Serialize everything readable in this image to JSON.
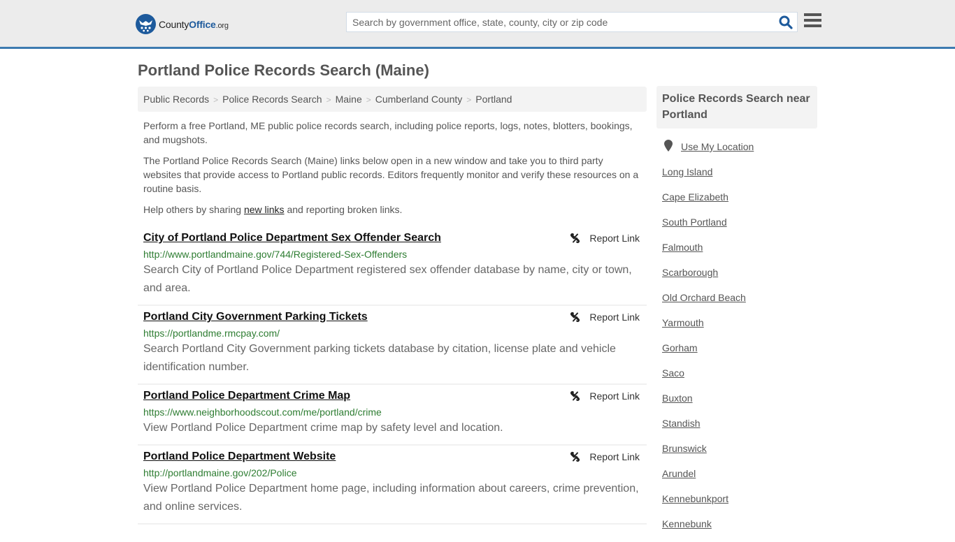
{
  "header": {
    "logo": {
      "part1": "County",
      "part2": "Office",
      "part3": ".org"
    },
    "search": {
      "placeholder": "Search by government office, state, county, city or zip code",
      "value": ""
    },
    "search_icon": "search-icon",
    "menu_icon": "hamburger-menu-icon",
    "colors": {
      "accent": "#3d7bb0",
      "brand": "#1d5a9c"
    }
  },
  "main": {
    "title": "Portland Police Records Search (Maine)",
    "breadcrumb": [
      "Public Records",
      "Police Records Search",
      "Maine",
      "Cumberland County",
      "Portland"
    ],
    "intro": {
      "p1": "Perform a free Portland, ME public police records search, including police reports, logs, notes, blotters, bookings, and mugshots.",
      "p2": "The Portland Police Records Search (Maine) links below open in a new window and take you to third party websites that provide access to Portland public records. Editors frequently monitor and verify these resources on a routine basis.",
      "p3_before": "Help others by sharing ",
      "p3_link": "new links",
      "p3_after": " and reporting broken links."
    },
    "report_label": "Report Link",
    "results": [
      {
        "title": "City of Portland Police Department Sex Offender Search",
        "url": "http://www.portlandmaine.gov/744/Registered-Sex-Offenders",
        "description": "Search City of Portland Police Department registered sex offender database by name, city or town, and area."
      },
      {
        "title": "Portland City Government Parking Tickets",
        "url": "https://portlandme.rmcpay.com/",
        "description": "Search Portland City Government parking tickets database by citation, license plate and vehicle identification number."
      },
      {
        "title": "Portland Police Department Crime Map",
        "url": "https://www.neighborhoodscout.com/me/portland/crime",
        "description": "View Portland Police Department crime map by safety level and location."
      },
      {
        "title": "Portland Police Department Website",
        "url": "http://portlandmaine.gov/202/Police",
        "description": "View Portland Police Department home page, including information about careers, crime prevention, and online services."
      }
    ]
  },
  "sidebar": {
    "heading": "Police Records Search near Portland",
    "use_location": "Use My Location",
    "places": [
      "Long Island",
      "Cape Elizabeth",
      "South Portland",
      "Falmouth",
      "Scarborough",
      "Old Orchard Beach",
      "Yarmouth",
      "Gorham",
      "Saco",
      "Buxton",
      "Standish",
      "Brunswick",
      "Arundel",
      "Kennebunkport",
      "Kennebunk"
    ]
  }
}
